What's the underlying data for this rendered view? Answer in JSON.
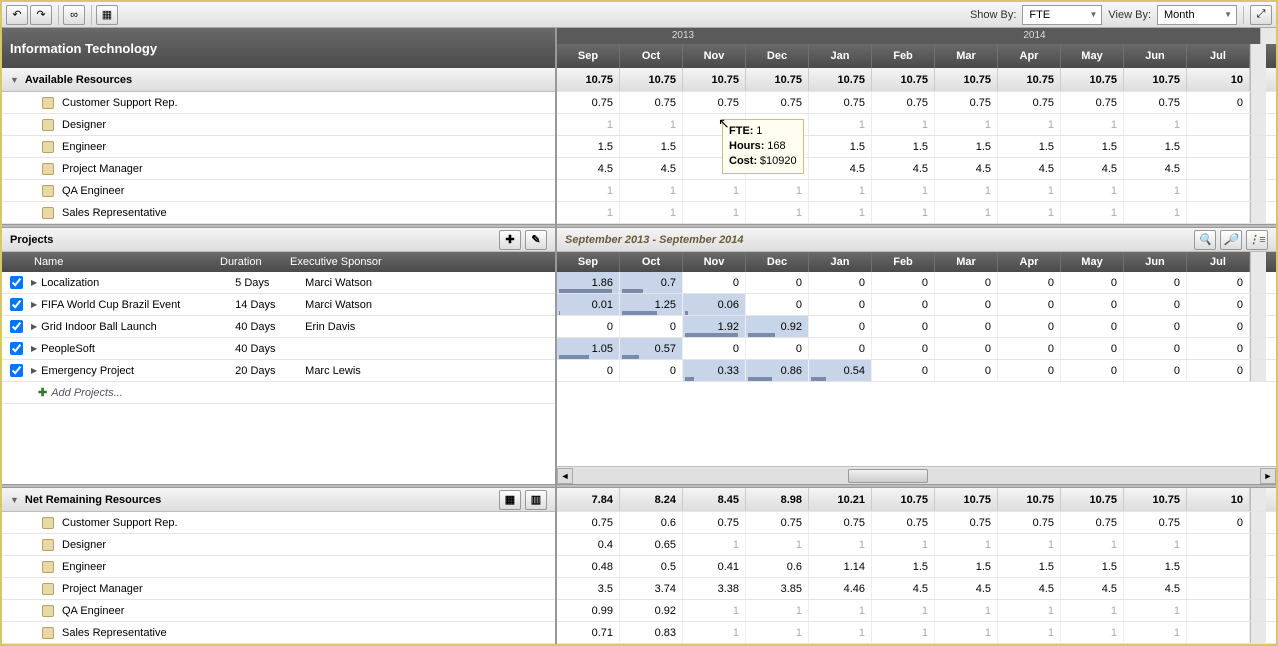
{
  "toolbar": {
    "show_by_label": "Show By:",
    "show_by_value": "FTE",
    "view_by_label": "View By:",
    "view_by_value": "Month"
  },
  "header_title": "Information Technology",
  "years": {
    "y1": "2013",
    "y2": "2014"
  },
  "months": [
    "Sep",
    "Oct",
    "Nov",
    "Dec",
    "Jan",
    "Feb",
    "Mar",
    "Apr",
    "May",
    "Jun",
    "Jul"
  ],
  "available": {
    "title": "Available Resources",
    "total": [
      "10.75",
      "10.75",
      "10.75",
      "10.75",
      "10.75",
      "10.75",
      "10.75",
      "10.75",
      "10.75",
      "10.75",
      "10"
    ],
    "rows": [
      {
        "name": "Customer Support Rep.",
        "vals": [
          "0.75",
          "0.75",
          "0.75",
          "0.75",
          "0.75",
          "0.75",
          "0.75",
          "0.75",
          "0.75",
          "0.75",
          "0"
        ]
      },
      {
        "name": "Designer",
        "vals": [
          "1",
          "1",
          "",
          "",
          "1",
          "1",
          "1",
          "1",
          "1",
          "1",
          ""
        ],
        "dim": true
      },
      {
        "name": "Engineer",
        "vals": [
          "1.5",
          "1.5",
          "",
          "1.5",
          "1.5",
          "1.5",
          "1.5",
          "1.5",
          "1.5",
          "1.5",
          ""
        ]
      },
      {
        "name": "Project Manager",
        "vals": [
          "4.5",
          "4.5",
          "",
          "4.5",
          "4.5",
          "4.5",
          "4.5",
          "4.5",
          "4.5",
          "4.5",
          ""
        ]
      },
      {
        "name": "QA Engineer",
        "vals": [
          "1",
          "1",
          "1",
          "1",
          "1",
          "1",
          "1",
          "1",
          "1",
          "1",
          ""
        ],
        "dim": true
      },
      {
        "name": "Sales Representative",
        "vals": [
          "1",
          "1",
          "1",
          "1",
          "1",
          "1",
          "1",
          "1",
          "1",
          "1",
          ""
        ],
        "dim": true
      }
    ]
  },
  "tooltip": {
    "fte": "FTE:",
    "fte_v": "1",
    "hours": "Hours:",
    "hours_v": "168",
    "cost": "Cost:",
    "cost_v": "$10920"
  },
  "projects": {
    "title": "Projects",
    "range": "September 2013 - September 2014",
    "cols": {
      "name": "Name",
      "duration": "Duration",
      "sponsor": "Executive Sponsor"
    },
    "months": [
      "Sep",
      "Oct",
      "Nov",
      "Dec",
      "Jan",
      "Feb",
      "Mar",
      "Apr",
      "May",
      "Jun",
      "Jul"
    ],
    "rows": [
      {
        "name": "Localization",
        "duration": "5 Days",
        "sponsor": "Marci Watson",
        "vals": [
          "1.86",
          "0.7",
          "0",
          "0",
          "0",
          "0",
          "0",
          "0",
          "0",
          "0",
          "0"
        ],
        "bars": [
          0.9,
          0.35
        ],
        "hl": [
          0,
          1
        ]
      },
      {
        "name": "FIFA World Cup Brazil Event",
        "duration": "14 Days",
        "sponsor": "Marci Watson",
        "vals": [
          "0.01",
          "1.25",
          "0.06",
          "0",
          "0",
          "0",
          "0",
          "0",
          "0",
          "0",
          "0"
        ],
        "bars": [
          0.02,
          0.6,
          0.05
        ],
        "hl": [
          0,
          1,
          2
        ]
      },
      {
        "name": "Grid Indoor Ball Launch",
        "duration": "40 Days",
        "sponsor": "Erin Davis",
        "vals": [
          "0",
          "0",
          "1.92",
          "0.92",
          "0",
          "0",
          "0",
          "0",
          "0",
          "0",
          "0"
        ],
        "bars": [
          0,
          0,
          0.9,
          0.45
        ],
        "hl": [
          2,
          3
        ]
      },
      {
        "name": "PeopleSoft",
        "duration": "40 Days",
        "sponsor": "",
        "vals": [
          "1.05",
          "0.57",
          "0",
          "0",
          "0",
          "0",
          "0",
          "0",
          "0",
          "0",
          "0"
        ],
        "bars": [
          0.5,
          0.28
        ],
        "hl": [
          0,
          1
        ]
      },
      {
        "name": "Emergency Project",
        "duration": "20 Days",
        "sponsor": "Marc Lewis",
        "vals": [
          "0",
          "0",
          "0.33",
          "0.86",
          "0.54",
          "0",
          "0",
          "0",
          "0",
          "0",
          "0"
        ],
        "bars": [
          0,
          0,
          0.15,
          0.4,
          0.25
        ],
        "hl": [
          2,
          3,
          4
        ]
      }
    ],
    "add": "Add Projects..."
  },
  "remaining": {
    "title": "Net Remaining Resources",
    "total": [
      "7.84",
      "8.24",
      "8.45",
      "8.98",
      "10.21",
      "10.75",
      "10.75",
      "10.75",
      "10.75",
      "10.75",
      "10"
    ],
    "rows": [
      {
        "name": "Customer Support Rep.",
        "vals": [
          "0.75",
          "0.6",
          "0.75",
          "0.75",
          "0.75",
          "0.75",
          "0.75",
          "0.75",
          "0.75",
          "0.75",
          "0"
        ]
      },
      {
        "name": "Designer",
        "vals": [
          "0.4",
          "0.65",
          "1",
          "1",
          "1",
          "1",
          "1",
          "1",
          "1",
          "1",
          ""
        ]
      },
      {
        "name": "Engineer",
        "vals": [
          "0.48",
          "0.5",
          "0.41",
          "0.6",
          "1.14",
          "1.5",
          "1.5",
          "1.5",
          "1.5",
          "1.5",
          ""
        ]
      },
      {
        "name": "Project Manager",
        "vals": [
          "3.5",
          "3.74",
          "3.38",
          "3.85",
          "4.46",
          "4.5",
          "4.5",
          "4.5",
          "4.5",
          "4.5",
          ""
        ]
      },
      {
        "name": "QA Engineer",
        "vals": [
          "0.99",
          "0.92",
          "1",
          "1",
          "1",
          "1",
          "1",
          "1",
          "1",
          "1",
          ""
        ]
      },
      {
        "name": "Sales Representative",
        "vals": [
          "0.71",
          "0.83",
          "1",
          "1",
          "1",
          "1",
          "1",
          "1",
          "1",
          "1",
          ""
        ]
      }
    ]
  }
}
